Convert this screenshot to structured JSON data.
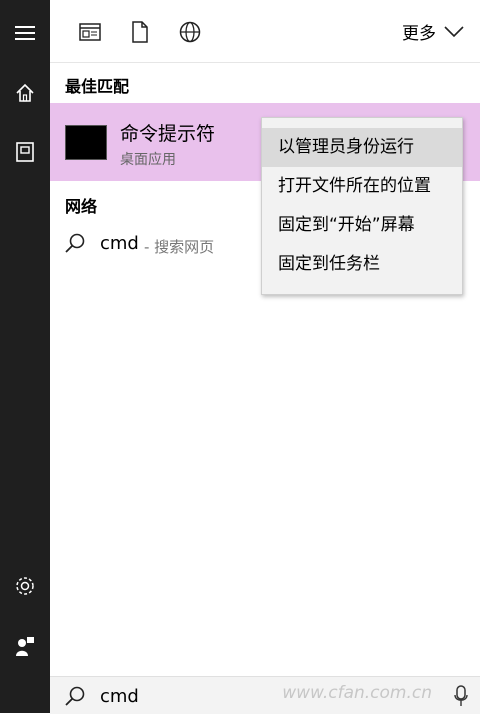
{
  "topbar": {
    "icons": [
      "document-window-icon",
      "file-icon",
      "globe-icon"
    ],
    "more_label": "更多"
  },
  "sections": {
    "best_match": "最佳匹配",
    "web": "网络"
  },
  "best_match": {
    "title": "命令提示符",
    "subtitle": "桌面应用"
  },
  "web_result": {
    "query": "cmd",
    "hint": "- 搜索网页"
  },
  "context_menu": {
    "items": [
      {
        "label": "以管理员身份运行",
        "highlighted": true
      },
      {
        "label": "打开文件所在的位置",
        "highlighted": false
      },
      {
        "label": "固定到“开始”屏幕",
        "highlighted": false
      },
      {
        "label": "固定到任务栏",
        "highlighted": false
      }
    ]
  },
  "search": {
    "value": "cmd"
  },
  "watermark": "www.cfan.com.cn",
  "rail": {
    "icons": [
      "hamburger-menu-icon",
      "home-icon",
      "notebook-icon",
      "settings-icon",
      "feedback-icon"
    ]
  },
  "colors": {
    "rail": "#1f1f1f",
    "highlight": "#e9c1ec",
    "menu_bg": "#f2f2f2",
    "menu_hover": "#dadada"
  }
}
